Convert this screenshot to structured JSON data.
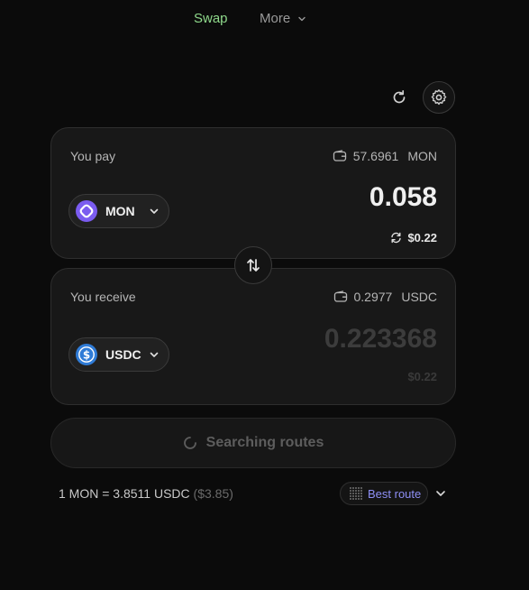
{
  "nav": {
    "swap_label": "Swap",
    "more_label": "More",
    "active_color": "#8fd98b"
  },
  "toolbar": {
    "refresh_icon": "refresh-icon",
    "settings_icon": "gear-icon"
  },
  "pay": {
    "label": "You pay",
    "balance": "57.6961",
    "balance_unit": "MON",
    "token": "MON",
    "amount": "0.058",
    "usd_value": "$0.22",
    "token_color": "#7b5cf0"
  },
  "receive": {
    "label": "You receive",
    "balance": "0.2977",
    "balance_unit": "USDC",
    "token": "USDC",
    "amount": "0.223368",
    "usd_value": "$0.22",
    "token_color": "#2f7bd6"
  },
  "cta": {
    "label": "Searching routes"
  },
  "rate": {
    "text": "1 MON = 3.8511 USDC",
    "usd": "($3.85)"
  },
  "route": {
    "label": "Best route",
    "accent": "#8e8ff5"
  }
}
